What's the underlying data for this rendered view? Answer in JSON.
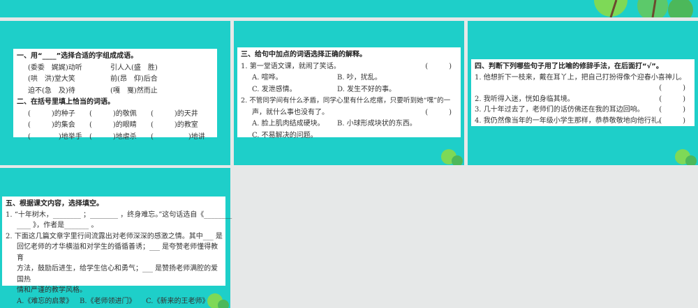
{
  "s1": {
    "h1": "一、用“____”选择合适的字组成成语。",
    "r1": [
      "(委委　娓娓)动听",
      "引人入(盛　胜)"
    ],
    "r2": [
      "(哄　洪)堂大笑",
      "前(昂　仰)后合"
    ],
    "r3": [
      "迫不(急　及)待",
      "(嘎　戛)然而止"
    ],
    "h2": "二、在括号里填上恰当的词语。",
    "g1": [
      "(　　　)的种子",
      "(　　　)的敬佩",
      "(　　　)的天井"
    ],
    "g2": [
      "(　　　)的集会",
      "(　　　)的眼睛",
      "(　　　)的教室"
    ],
    "g3": [
      "(　　　　)地举手",
      "(　　　)地虐杀",
      "(　　　　　)地讲"
    ]
  },
  "s3": {
    "h": "三、给句中加点的词语选择正确的解释。",
    "q1": "1. 第一堂语文课，就闹了笑话。",
    "q1o": [
      "A. 喧哗。",
      "B. 吵，扰乱。",
      "C. 发泄感情。",
      "D. 发生不好的事。"
    ],
    "q2": "2. 不管同学间有什么矛盾，同学心里有什么疙瘩，只要听到她“嘿”的一",
    "q2b": "声，就什么事也没有了。",
    "q2o": [
      "A. 脸上肌肉结成硬块。",
      "B. 小球形成块状的东西。",
      "C. 不易解决的问题。"
    ],
    "paren": "(　　　)"
  },
  "s4": {
    "h": "四、判断下列哪些句子用了比喻的修辞手法，在后面打“√”。",
    "items": [
      "1. 他想折下一枝来，戴在耳丫上，把自己打扮得像个迎春小喜神儿。",
      "2. 我听得入迷，恍如身临其境。",
      "3. 几十年过去了，老师们的话仿佛还在我的耳边回响。",
      "4. 我仍然像当年的一年级小学生那样，恭恭敬敬地向他行礼。"
    ],
    "paren": "(　　　)"
  },
  "s5": {
    "h": "五、根据课文内容，选择填空。",
    "l1": "1. “十年树木，________ ；________ ，终身难忘。”这句话选自《________",
    "l2": "____ 》，作者是_______ 。",
    "l3": "2. 下面这几篇文章字里行间流露出对老师深深的感激之情。其中___ 是",
    "l4": "回忆老师的才华横溢和对学生的循循善诱；___ 是夸赞老师懂得教育",
    "l5": "方法，鼓励后进生，给学生信心和勇气；___ 是赞扬老师满腔的爱国热",
    "l6": "情和严谨的教学风格。",
    "opts": [
      "A.《难忘的启蒙》",
      "B.《老师领进门》",
      "C.《新来的王老师》"
    ]
  }
}
